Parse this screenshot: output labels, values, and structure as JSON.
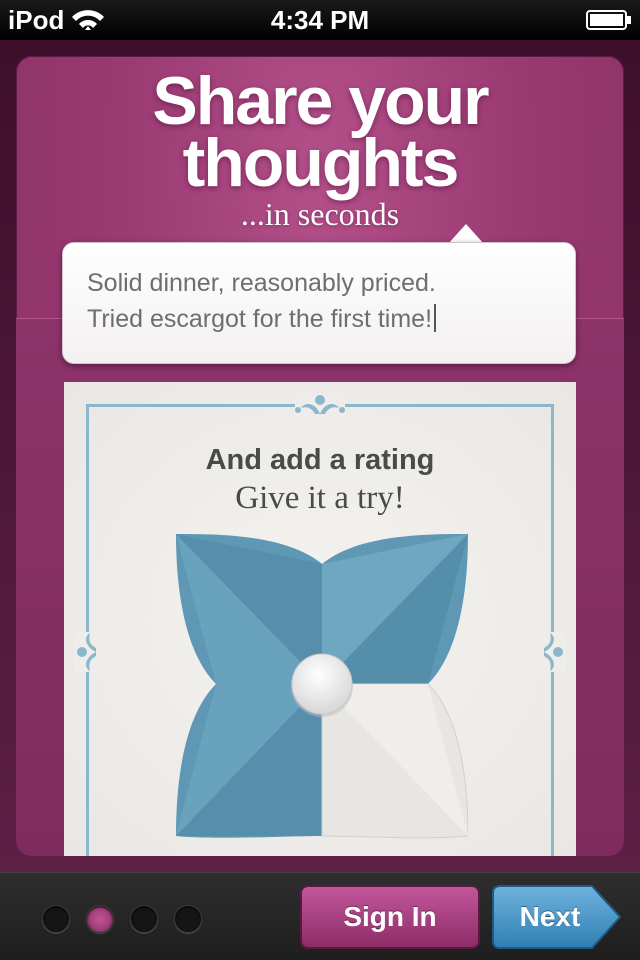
{
  "status_bar": {
    "carrier": "iPod",
    "time": "4:34 PM"
  },
  "headline": {
    "line1": "Share your",
    "line2": "thoughts",
    "subtitle": "...in seconds"
  },
  "review_bubble": {
    "line1": "Solid dinner, reasonably priced.",
    "line2": "Tried escargot for the first time!"
  },
  "rating_card": {
    "title": "And add a rating",
    "subtitle": "Give it a try!",
    "rating_value": 3,
    "rating_max": 4
  },
  "pager": {
    "count": 4,
    "active_index": 1
  },
  "buttons": {
    "sign_in": "Sign In",
    "next": "Next"
  },
  "colors": {
    "brand_magenta": "#9b3a73",
    "accent_blue": "#5f98b5",
    "petal_empty": "#e8e6e3"
  }
}
